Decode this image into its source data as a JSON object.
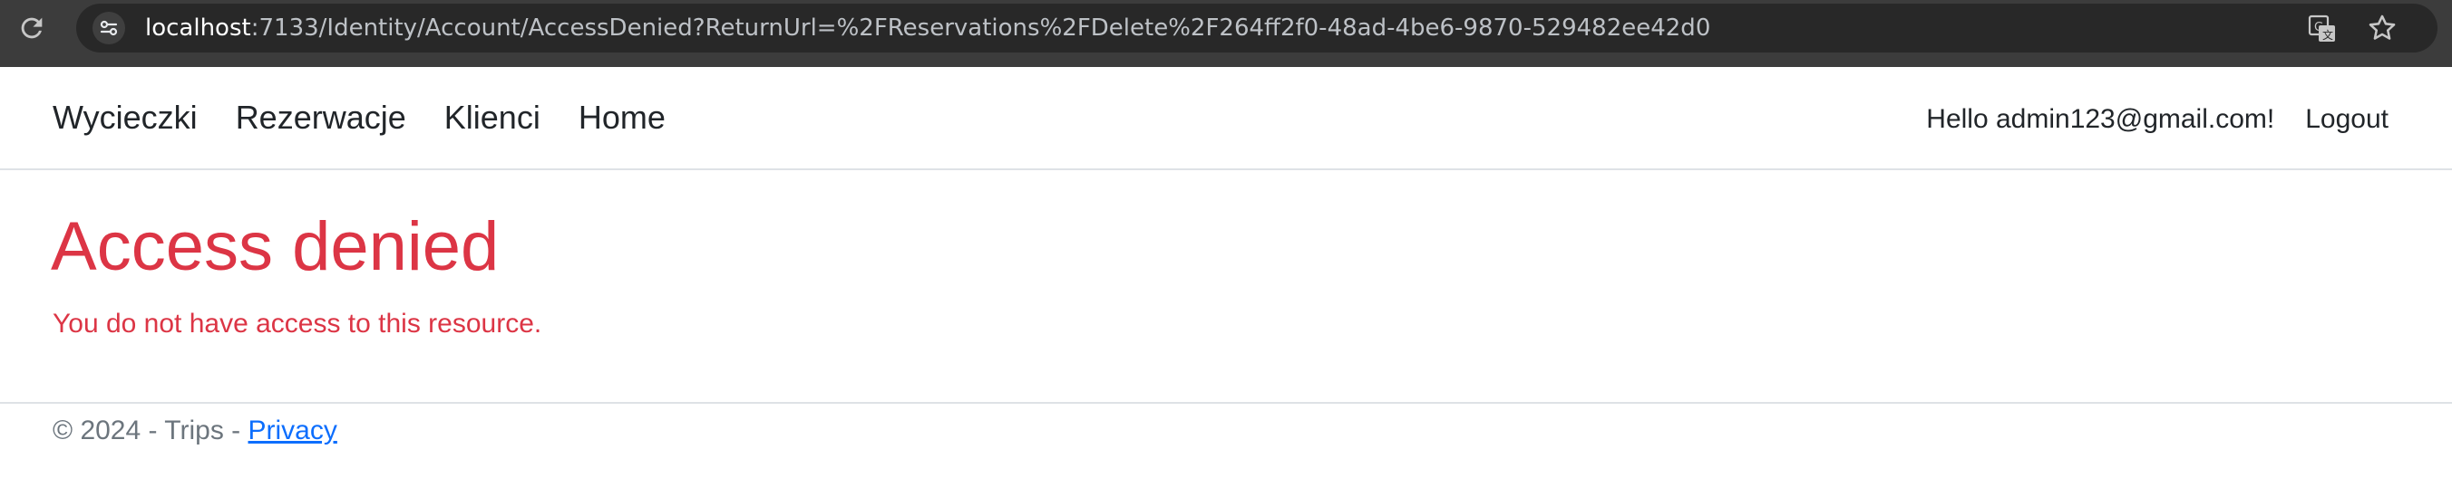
{
  "browser": {
    "url_host": "localhost",
    "url_rest": ":7133/Identity/Account/AccessDenied?ReturnUrl=%2FReservations%2FDelete%2F264ff2f0-48ad-4be6-9870-529482ee42d0",
    "icons": [
      "reload-icon",
      "site-info-icon",
      "translate-icon",
      "star-icon"
    ]
  },
  "navbar": {
    "links": [
      {
        "label": "Wycieczki"
      },
      {
        "label": "Rezerwacje"
      },
      {
        "label": "Klienci"
      },
      {
        "label": "Home"
      }
    ],
    "greeting": "Hello admin123@gmail.com!",
    "logout_label": "Logout"
  },
  "main": {
    "heading": "Access denied",
    "message": "You do not have access to this resource."
  },
  "footer": {
    "copyright": "© 2024 - Trips - ",
    "privacy_label": "Privacy"
  },
  "colors": {
    "danger": "#dc3545",
    "link": "#0d6efd",
    "chrome_bg": "#3c3c3c",
    "omnibox_bg": "#282828"
  }
}
